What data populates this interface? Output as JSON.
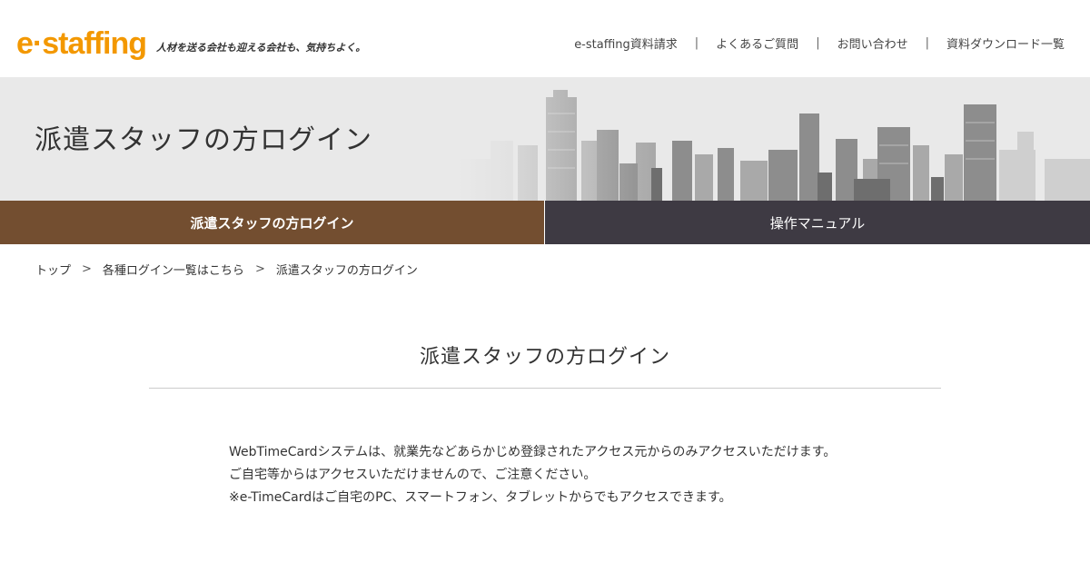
{
  "header": {
    "logo": {
      "prefix": "e",
      "dot": "·",
      "suffix": "staffing"
    },
    "tagline": "人材を送る会社も迎える会社も、気持ちよく。",
    "nav": [
      {
        "label": "e-staffing資料請求"
      },
      {
        "label": "よくあるご質問"
      },
      {
        "label": "お問い合わせ"
      },
      {
        "label": "資料ダウンロード一覧"
      }
    ],
    "nav_separator": "|"
  },
  "hero": {
    "title": "派遣スタッフの方ログイン"
  },
  "tabs": [
    {
      "label": "派遣スタッフの方ログイン",
      "active": true
    },
    {
      "label": "操作マニュアル",
      "active": false
    }
  ],
  "breadcrumb": {
    "items": [
      "トップ",
      "各種ログイン一覧はこちら",
      "派遣スタッフの方ログイン"
    ],
    "separator": ">"
  },
  "main": {
    "title": "派遣スタッフの方ログイン",
    "notice": [
      "WebTimeCardシステムは、就業先などあらかじめ登録されたアクセス元からのみアクセスいただけます。",
      "ご自宅等からはアクセスいただけませんので、ご注意ください。",
      "※e-TimeCardはご自宅のPC、スマートフォン、タブレットからでもアクセスできます。"
    ]
  },
  "colors": {
    "logo": "#f39800",
    "tab_active": "#734e30",
    "tab_inactive": "#3e3a43",
    "hero_bg": "#e9e9e9"
  }
}
